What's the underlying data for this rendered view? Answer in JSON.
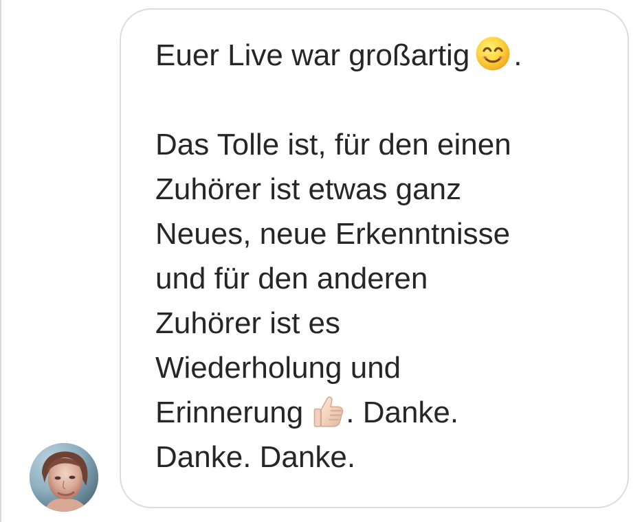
{
  "conversation": {
    "message": {
      "sender": {
        "avatar_icon": "profile-photo"
      },
      "lines": [
        {
          "text": "Euer Live war großartig",
          "suffix": ".",
          "emoji": "smiling-face-icon"
        },
        {
          "text": ""
        },
        {
          "text": "Das Tolle ist, für den einen"
        },
        {
          "text": "Zuhörer ist etwas ganz"
        },
        {
          "text": "Neues, neue Erkenntnisse"
        },
        {
          "text": "und für den anderen"
        },
        {
          "text": "Zuhörer ist es"
        },
        {
          "text": "Wiederholung und"
        },
        {
          "text": "Erinnerung",
          "suffix": ". Danke.",
          "emoji": "thumbs-up-icon"
        },
        {
          "text": "Danke. Danke."
        }
      ]
    }
  },
  "colors": {
    "text": "#262626",
    "bubble_border": "#dcdcdc",
    "background": "#ffffff"
  }
}
